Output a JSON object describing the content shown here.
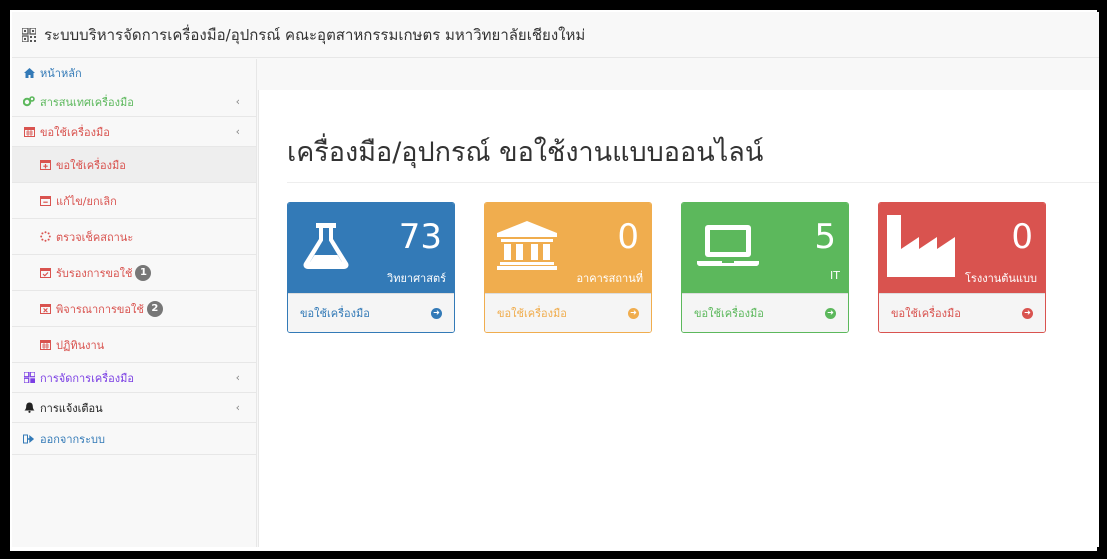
{
  "header": {
    "brand_icon": "barcode-icon",
    "title": "ระบบบริหารจัดการเครื่องมือ/อุปกรณ์ คณะอุตสาหกรรมเกษตร มหาวิทยาลัยเชียงใหม่"
  },
  "sidebar": {
    "home": {
      "label": "หน้าหลัก",
      "icon": "home-icon"
    },
    "items": [
      {
        "label": "สารสนเทศเครื่องมือ",
        "icon": "cogs-icon",
        "caret": "‹",
        "color": "#5cb85c"
      },
      {
        "label": "ขอใช้เครื่องมือ",
        "icon": "calendar-icon",
        "caret": "‹",
        "color": "#d9534f"
      },
      {
        "label": "ขอใช้เครื่องมือ",
        "icon": "calendar-plus-icon",
        "color": "#d9534f"
      },
      {
        "label": "แก้ไข/ยกเลิก",
        "icon": "calendar-minus-icon",
        "color": "#d9534f"
      },
      {
        "label": "ตรวจเช็คสถานะ",
        "icon": "spinner-icon",
        "color": "#d9534f"
      },
      {
        "label": "รับรองการขอใช้",
        "icon": "calendar-check-icon",
        "badge": "1",
        "color": "#d9534f"
      },
      {
        "label": "พิจารณาการขอใช้",
        "icon": "calendar-times-icon",
        "badge": "2",
        "color": "#d9534f"
      },
      {
        "label": "ปฏิทินงาน",
        "icon": "calendar-icon",
        "color": "#d9534f"
      },
      {
        "label": "การจัดการเครื่องมือ",
        "icon": "barcode-icon",
        "caret": "‹",
        "color": "#7b3fe4"
      },
      {
        "label": "การแจ้งเตือน",
        "icon": "bell-icon",
        "caret": "‹",
        "color": "#222222"
      },
      {
        "label": "ออกจากระบบ",
        "icon": "sign-out-icon",
        "color": "#337ab7"
      }
    ]
  },
  "main": {
    "title": "เครื่องมือ/อุปกรณ์ ขอใช้งานแบบออนไลน์",
    "panels": [
      {
        "count": "73",
        "label": "วิทยาศาสตร์",
        "link": "ขอใช้เครื่องมือ",
        "icon": "flask-icon",
        "color": "#337ab7"
      },
      {
        "count": "0",
        "label": "อาคารสถานที่",
        "link": "ขอใช้เครื่องมือ",
        "icon": "institution-icon",
        "color": "#f0ad4e"
      },
      {
        "count": "5",
        "label": "IT",
        "link": "ขอใช้เครื่องมือ",
        "icon": "laptop-icon",
        "color": "#5cb85c"
      },
      {
        "count": "0",
        "label": "โรงงานต้นแบบ",
        "link": "ขอใช้เครื่องมือ",
        "icon": "industry-icon",
        "color": "#d9534f"
      }
    ]
  }
}
